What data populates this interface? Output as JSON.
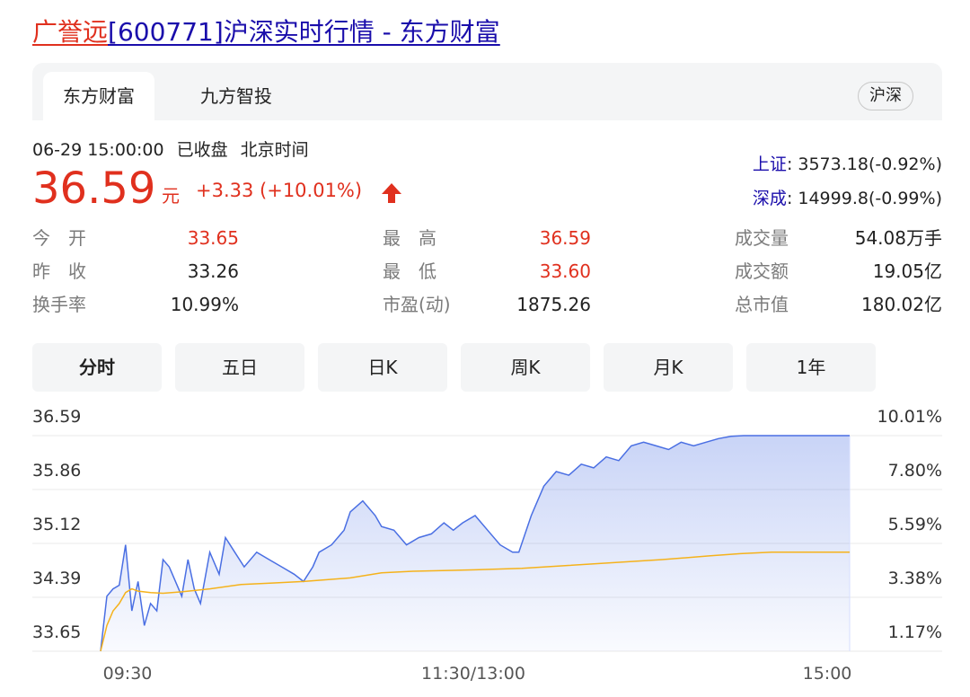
{
  "title": {
    "name": "广誉远",
    "rest": "[600771]沪深实时行情 - 东方财富"
  },
  "tabs": [
    {
      "label": "东方财富",
      "active": true
    },
    {
      "label": "九方智投",
      "active": false
    }
  ],
  "market_pill": "沪深",
  "quote": {
    "date_time": "06-29 15:00:00",
    "status": "已收盘",
    "timezone": "北京时间",
    "price": "36.59",
    "unit": "元",
    "change": "+3.33 (+10.01%)",
    "direction_icon": "up-arrow-icon"
  },
  "indices": [
    {
      "name": "上证",
      "value": ": 3573.18(-0.92%)"
    },
    {
      "name": "深成",
      "value": ": 14999.8(-0.99%)"
    }
  ],
  "stats": {
    "col1": [
      {
        "label": "今　开",
        "value": "33.65",
        "color": "#e0301e"
      },
      {
        "label": "昨　收",
        "value": "33.26",
        "color": "#222222"
      },
      {
        "label": "换手率",
        "value": "10.99%",
        "color": "#222222"
      }
    ],
    "col2": [
      {
        "label": "最　高",
        "value": "36.59",
        "color": "#e0301e"
      },
      {
        "label": "最　低",
        "value": "33.60",
        "color": "#e0301e"
      },
      {
        "label": "市盈(动)",
        "value": "1875.26",
        "color": "#222222"
      }
    ],
    "col3": [
      {
        "label": "成交量",
        "value": "54.08万手",
        "color": "#222222"
      },
      {
        "label": "成交额",
        "value": "19.05亿",
        "color": "#222222"
      },
      {
        "label": "总市值",
        "value": "180.02亿",
        "color": "#222222"
      }
    ]
  },
  "period_tabs": [
    {
      "label": "分时",
      "active": true
    },
    {
      "label": "五日",
      "active": false
    },
    {
      "label": "日K",
      "active": false
    },
    {
      "label": "周K",
      "active": false
    },
    {
      "label": "月K",
      "active": false
    },
    {
      "label": "1年",
      "active": false
    }
  ],
  "colors": {
    "up": "#e0301e",
    "link": "#1a0dab",
    "price_line": "#4a6fe3",
    "avg_line": "#f5b21b"
  },
  "chart_data": {
    "type": "line",
    "y_labels_left": [
      "36.59",
      "35.86",
      "35.12",
      "34.39",
      "33.65"
    ],
    "y_labels_right": [
      "10.01%",
      "7.80%",
      "5.59%",
      "3.38%",
      "1.17%"
    ],
    "x_labels": [
      "09:30",
      "11:30/13:00",
      "15:00"
    ],
    "ylim": [
      33.65,
      36.59
    ],
    "x_range_minutes": [
      0,
      240
    ],
    "grid": true,
    "series": [
      {
        "style": "price",
        "x": [
          0,
          2,
          4,
          6,
          8,
          10,
          12,
          14,
          16,
          18,
          20,
          22,
          24,
          26,
          28,
          30,
          32,
          35,
          38,
          40,
          43,
          46,
          50,
          54,
          58,
          62,
          65,
          68,
          70,
          74,
          78,
          80,
          84,
          88,
          90,
          94,
          98,
          102,
          106,
          110,
          113,
          116,
          120,
          124,
          128,
          132,
          134,
          138,
          142,
          146,
          150,
          154,
          158,
          162,
          166,
          170,
          174,
          178,
          182,
          186,
          190,
          194,
          198,
          202,
          206,
          210,
          240
        ],
        "y": [
          33.65,
          34.4,
          34.5,
          34.55,
          35.1,
          34.2,
          34.6,
          34.0,
          34.3,
          34.2,
          34.9,
          34.8,
          34.6,
          34.4,
          34.9,
          34.5,
          34.3,
          35.0,
          34.7,
          35.2,
          35.0,
          34.8,
          35.0,
          34.9,
          34.8,
          34.7,
          34.6,
          34.8,
          35.0,
          35.1,
          35.3,
          35.55,
          35.7,
          35.5,
          35.35,
          35.3,
          35.1,
          35.2,
          35.25,
          35.4,
          35.3,
          35.4,
          35.5,
          35.3,
          35.1,
          35.0,
          35.0,
          35.5,
          35.9,
          36.1,
          36.05,
          36.2,
          36.15,
          36.3,
          36.25,
          36.45,
          36.5,
          36.45,
          36.4,
          36.5,
          36.45,
          36.5,
          36.55,
          36.58,
          36.59,
          36.59,
          36.59
        ]
      },
      {
        "style": "average",
        "x": [
          0,
          2,
          4,
          6,
          8,
          10,
          12,
          16,
          20,
          26,
          35,
          45,
          55,
          65,
          80,
          90,
          100,
          120,
          135,
          150,
          165,
          180,
          195,
          205,
          215,
          240
        ],
        "y": [
          33.65,
          34.0,
          34.2,
          34.3,
          34.45,
          34.5,
          34.47,
          34.45,
          34.44,
          34.46,
          34.5,
          34.56,
          34.58,
          34.6,
          34.65,
          34.72,
          34.74,
          34.76,
          34.78,
          34.82,
          34.86,
          34.9,
          34.95,
          34.98,
          35.0,
          35.0
        ]
      }
    ]
  }
}
